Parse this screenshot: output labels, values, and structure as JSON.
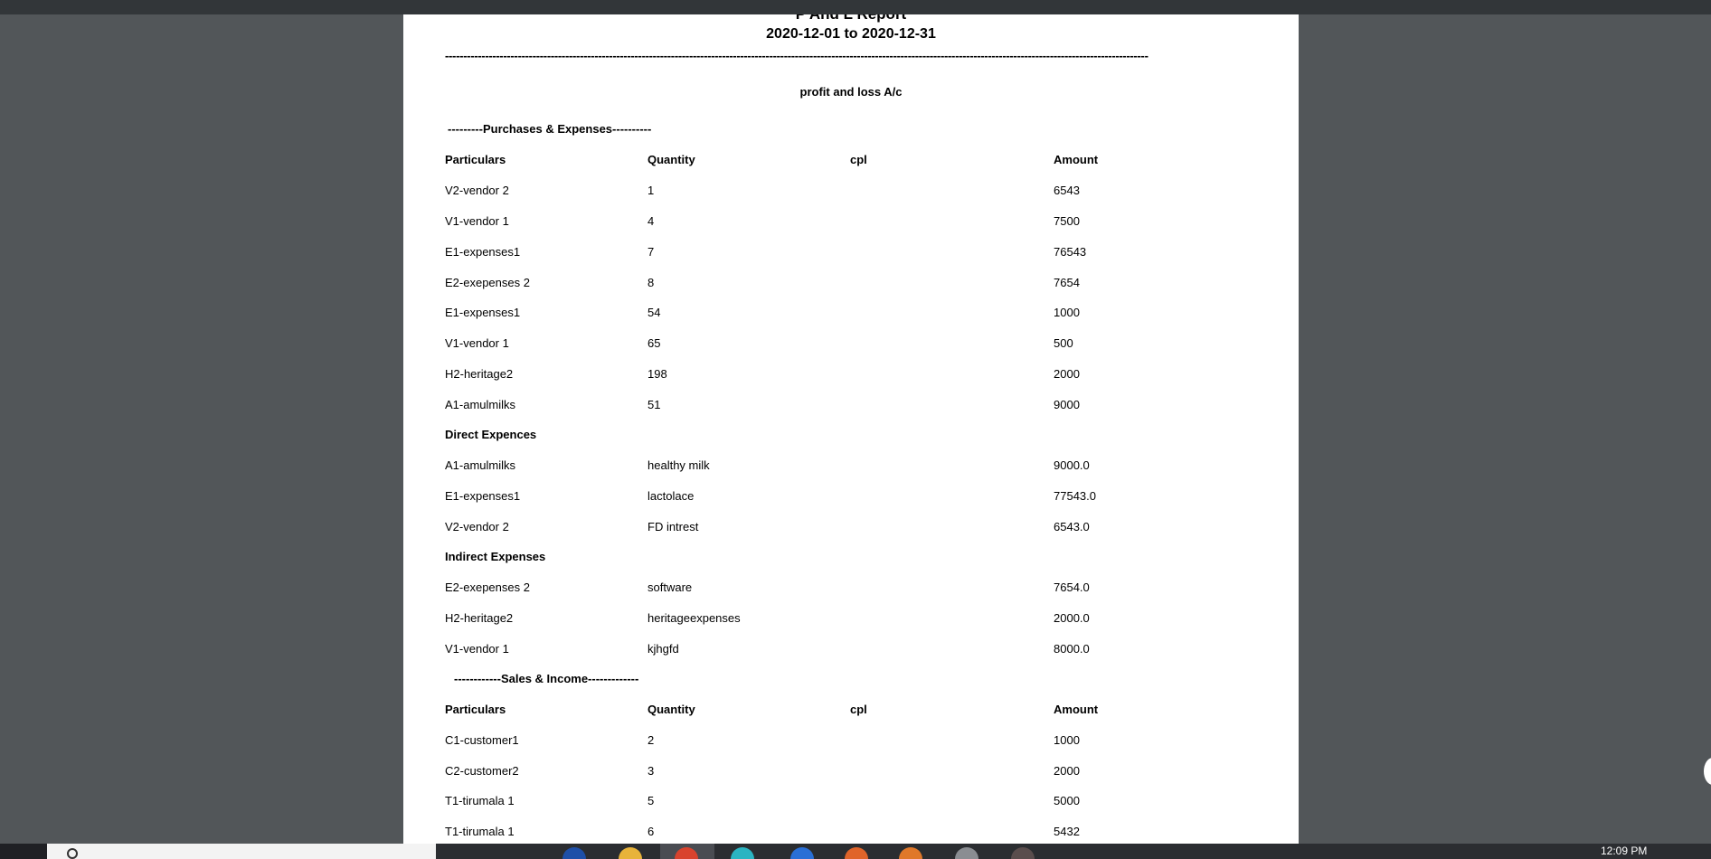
{
  "report": {
    "title": "P And L Report",
    "date_range": "2020-12-01 to 2020-12-31",
    "divider": "-------------------------------------------------------------------------------------------------------------------------------------------------------------------------------------------------",
    "heading": "profit and loss A/c"
  },
  "purchases": {
    "section_title": "---------Purchases & Expenses----------",
    "columns": [
      "Particulars",
      "Quantity",
      "cpl",
      "Amount"
    ],
    "rows": [
      [
        "V2-vendor 2",
        "1",
        "",
        "6543"
      ],
      [
        "V1-vendor 1",
        "4",
        "",
        "7500"
      ],
      [
        "E1-expenses1",
        "7",
        "",
        "76543"
      ],
      [
        "E2-exepenses 2",
        "8",
        "",
        "7654"
      ],
      [
        "E1-expenses1",
        "54",
        "",
        "1000"
      ],
      [
        "V1-vendor 1",
        "65",
        "",
        "500"
      ],
      [
        "H2-heritage2",
        "198",
        "",
        "2000"
      ],
      [
        "A1-amulmilks",
        "51",
        "",
        "9000"
      ]
    ]
  },
  "direct_expenses": {
    "title": "Direct Expences",
    "rows": [
      [
        "A1-amulmilks",
        "healthy milk",
        "",
        "9000.0"
      ],
      [
        "E1-expenses1",
        "lactolace",
        "",
        "77543.0"
      ],
      [
        "V2-vendor 2",
        "FD intrest",
        "",
        "6543.0"
      ]
    ]
  },
  "indirect_expenses": {
    "title": "Indirect Expenses",
    "rows": [
      [
        "E2-exepenses 2",
        "software",
        "",
        "7654.0"
      ],
      [
        "H2-heritage2",
        "heritageexpenses",
        "",
        "2000.0"
      ],
      [
        "V1-vendor 1",
        "kjhgfd",
        "",
        "8000.0"
      ]
    ]
  },
  "sales": {
    "section_title": "------------Sales & Income-------------",
    "columns": [
      "Particulars",
      "Quantity",
      "cpl",
      "Amount"
    ],
    "rows": [
      [
        "C1-customer1",
        "2",
        "",
        "1000"
      ],
      [
        "C2-customer2",
        "3",
        "",
        "2000"
      ],
      [
        "T1-tirumala 1",
        "5",
        "",
        "5000"
      ],
      [
        "T1-tirumala 1",
        "6",
        "",
        "5432"
      ]
    ]
  },
  "taskbar": {
    "clock": "12:09 PM"
  }
}
